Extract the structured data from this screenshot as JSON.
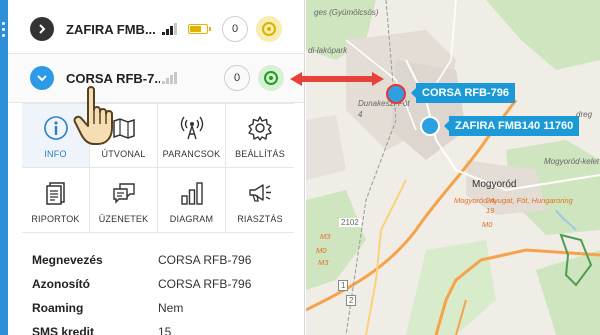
{
  "vehicles": [
    {
      "name": "ZAFIRA FMB...",
      "messages": "0",
      "status": "yellow"
    },
    {
      "name": "CORSA RFB-7...",
      "messages": "0",
      "status": "green"
    }
  ],
  "actions": [
    {
      "label": "INFO",
      "icon": "info-icon",
      "active": true
    },
    {
      "label": "ÚTVONAL",
      "icon": "route-map-icon"
    },
    {
      "label": "PARANCSOK",
      "icon": "antenna-icon"
    },
    {
      "label": "BEÁLLÍTÁS",
      "icon": "gear-icon"
    },
    {
      "label": "RIPORTOK",
      "icon": "document-icon"
    },
    {
      "label": "ÜZENETEK",
      "icon": "chat-icon"
    },
    {
      "label": "DIAGRAM",
      "icon": "bar-chart-icon"
    },
    {
      "label": "RIASZTÁS",
      "icon": "megaphone-icon"
    }
  ],
  "info": [
    {
      "key": "Megnevezés",
      "value": "CORSA RFB-796"
    },
    {
      "key": "Azonosító",
      "value": "CORSA RFB-796"
    },
    {
      "key": "Roaming",
      "value": "Nem"
    },
    {
      "key": "SMS kredit",
      "value": "15"
    }
  ],
  "map": {
    "labels": [
      "ges (Gyümölcsös)",
      "di-lakópark",
      "Dunakeszi-Fót",
      "4",
      "Mogyoród-kelet",
      "Mogyoród",
      "Mogyoród-nyugat, Fót, Hungaroring",
      "M0",
      "2102",
      "M3",
      "M0",
      "2A",
      "19",
      "M3",
      "dreg",
      "1",
      "2"
    ],
    "callouts": [
      {
        "text": "CORSA RFB-796"
      },
      {
        "text": "ZAFIRA FMB140 11760"
      }
    ]
  },
  "colors": {
    "accent": "#2d8fd5",
    "callout": "#1c9ad8",
    "arrow": "#e8413a"
  }
}
